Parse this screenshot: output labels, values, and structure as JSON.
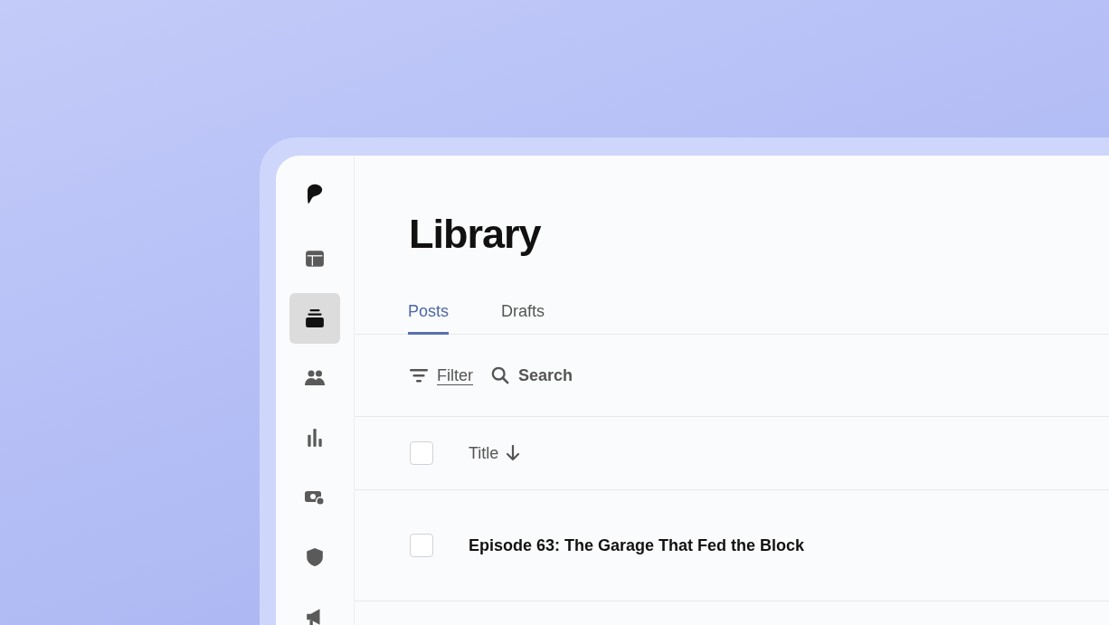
{
  "sidebar": {
    "items": [
      {
        "kind": "logo"
      },
      {
        "kind": "layout",
        "selected": false
      },
      {
        "kind": "library",
        "selected": true
      },
      {
        "kind": "people",
        "selected": false
      },
      {
        "kind": "chart",
        "selected": false
      },
      {
        "kind": "money",
        "selected": false
      },
      {
        "kind": "shield",
        "selected": false
      },
      {
        "kind": "megaphone",
        "selected": false
      }
    ]
  },
  "page": {
    "title": "Library"
  },
  "tabs": [
    {
      "label": "Posts",
      "selected": true
    },
    {
      "label": "Drafts",
      "selected": false
    }
  ],
  "toolbar": {
    "filter": "Filter",
    "search": "Search"
  },
  "table": {
    "select_all_checked": false,
    "columns": [
      {
        "label": "Title",
        "sort_descending": true
      }
    ],
    "rows": [
      {
        "title": "Episode 63: The Garage That Fed the Block",
        "checked": false
      }
    ]
  }
}
